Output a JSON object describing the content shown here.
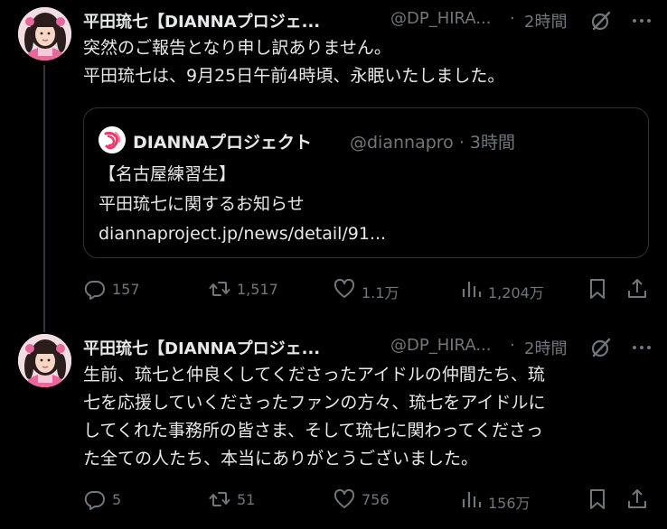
{
  "colors": {
    "background": "#000000",
    "text_primary": "#e7e9ea",
    "text_secondary": "#71767b",
    "border": "#2f3336",
    "thread_line": "#333639",
    "avatar_accent": "#e9679a"
  },
  "tweets": [
    {
      "author": {
        "display_name": "平田琉七【DIANNAプロジェ...",
        "handle": "@DP_HIRA...",
        "avatar_icon": "avatar-girl-pink-costume"
      },
      "separator": "·",
      "time": "2時間",
      "body_lines": [
        "突然のご報告となり申し訳ありません。",
        "平田琉七は、9月25日午前4時頃、永眠いたしました。"
      ],
      "quote": {
        "logo_icon": "dianna-logo-icon",
        "display_name": "DIANNAプロジェクト",
        "handle_time": "@diannapro · 3時間",
        "lines": [
          "【名古屋練習生】",
          "平田琉七に関するお知らせ",
          "diannaproject.jp/news/detail/91..."
        ]
      },
      "actions": {
        "replies": "157",
        "reposts": "1,517",
        "likes": "1.1万",
        "views": "1,204万"
      }
    },
    {
      "author": {
        "display_name": "平田琉七【DIANNAプロジェ...",
        "handle": "@DP_HIRA...",
        "avatar_icon": "avatar-girl-pink-costume"
      },
      "separator": "·",
      "time": "2時間",
      "body_lines": [
        "生前、琉七と仲良くしてくださったアイドルの仲間たち、琉",
        "七を応援していくださったファンの方々、琉七をアイドルに",
        "してくれた事務所の皆さま、そして琉七に関わってくださっ",
        "た全ての人たち、本当にありがとうございました。"
      ],
      "actions": {
        "replies": "5",
        "reposts": "51",
        "likes": "756",
        "views": "156万"
      }
    }
  ]
}
